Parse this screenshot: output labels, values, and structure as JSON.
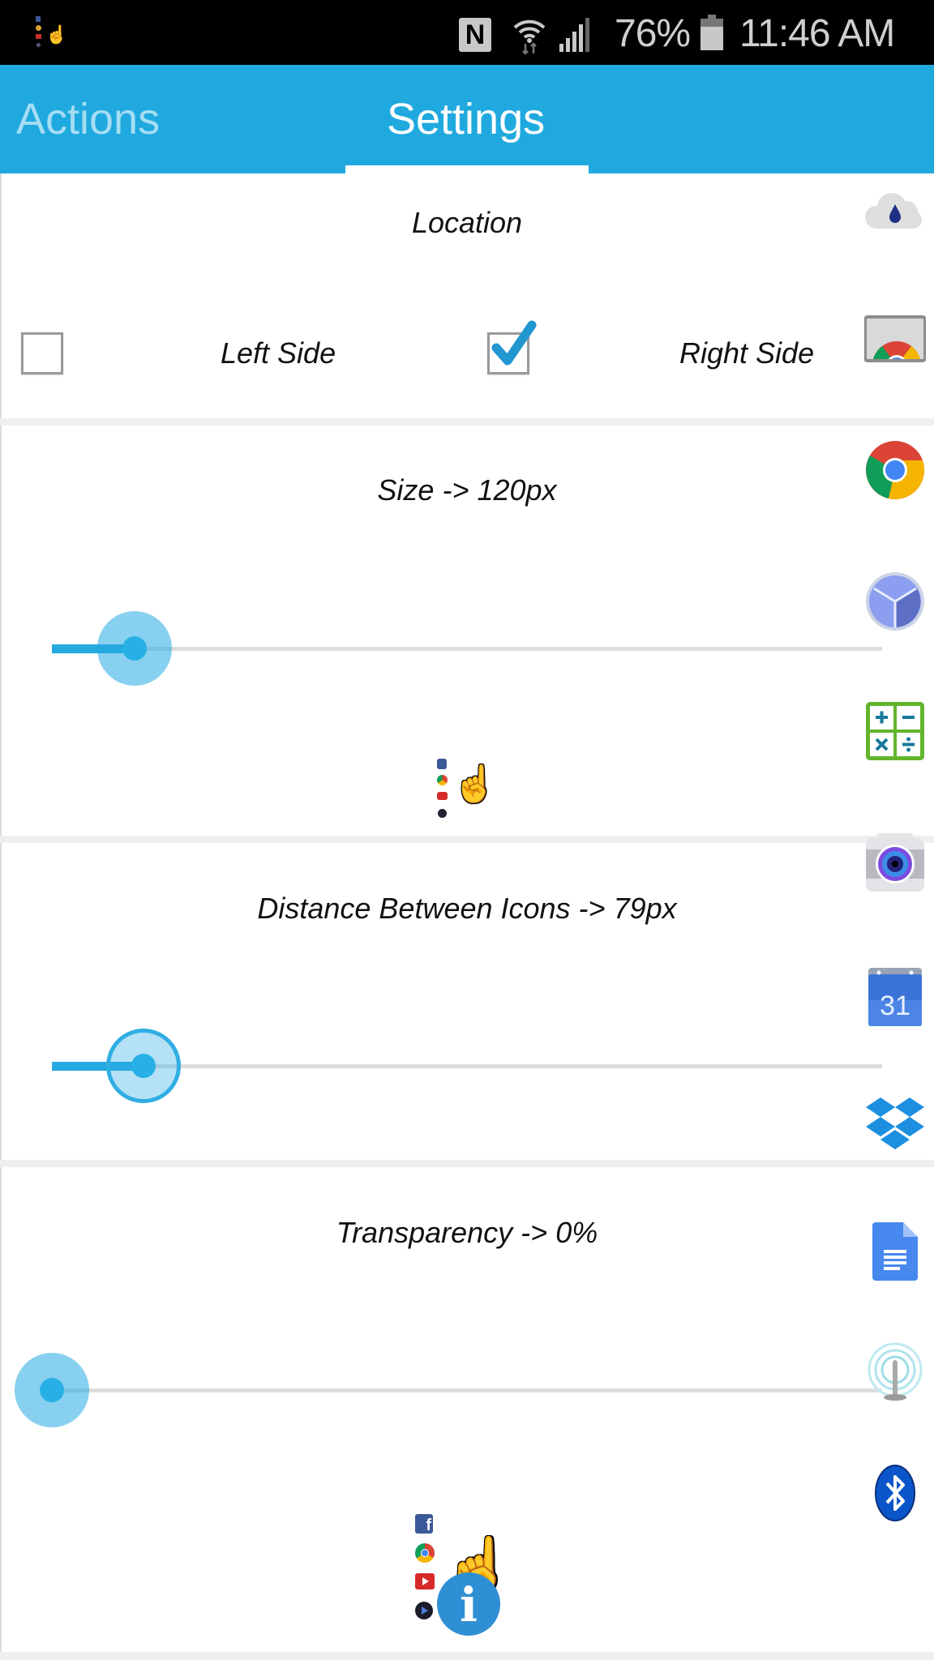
{
  "status_bar": {
    "notification_icon": "stacked-app-icons-hand",
    "nfc_icon": "N",
    "battery_percent": "76%",
    "time": "11:46 AM"
  },
  "tabs": [
    {
      "label": "Actions",
      "active": false
    },
    {
      "label": "Settings",
      "active": true
    }
  ],
  "location": {
    "title": "Location",
    "options": [
      {
        "label": "Left Side",
        "checked": false
      },
      {
        "label": "Right Side",
        "checked": true
      }
    ]
  },
  "size": {
    "title": "Size -> 120px",
    "value_fraction": 0.1
  },
  "distance": {
    "title": "Distance Between Icons -> 79px",
    "value_fraction": 0.11
  },
  "transparency": {
    "title": "Transparency -> 0%",
    "value_fraction": 0.0
  },
  "info_button": {
    "label": "i"
  },
  "calendar_day": "31",
  "side_icons": [
    "weather-cloud",
    "chromecast",
    "chrome",
    "clock",
    "calculator",
    "camera",
    "calendar",
    "dropbox",
    "google-docs",
    "wifi-hotspot",
    "bluetooth"
  ],
  "preview_icons": [
    "facebook",
    "chrome",
    "youtube",
    "media-player"
  ],
  "colors": {
    "accent": "#20a9df",
    "slider": "#27a9e1",
    "tab_inactive_text": "#a5ddf3"
  }
}
